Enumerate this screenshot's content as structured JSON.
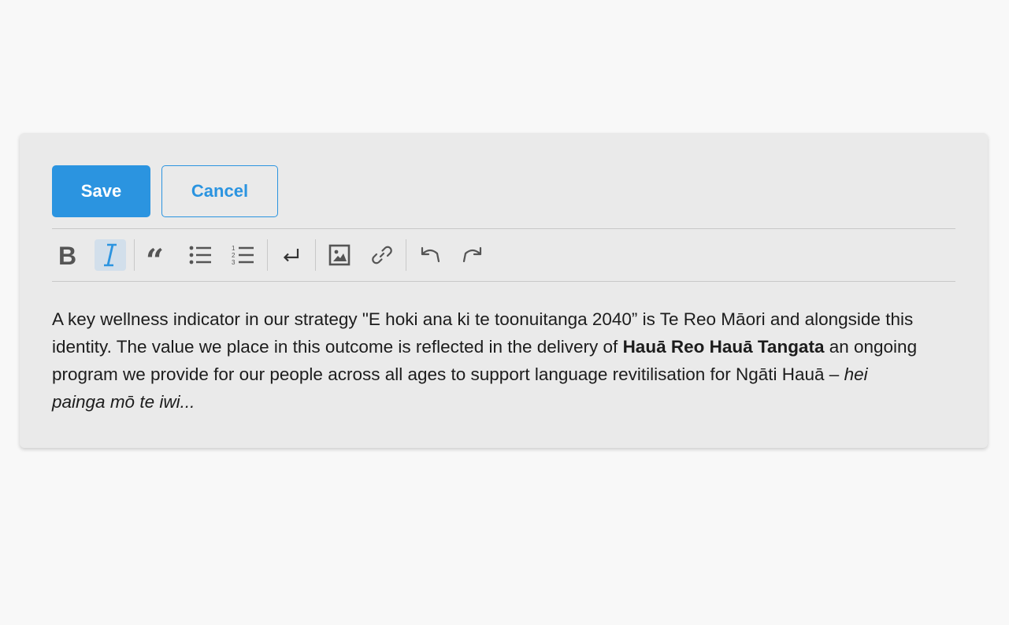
{
  "actions": {
    "save_label": "Save",
    "cancel_label": "Cancel"
  },
  "toolbar": {
    "items": [
      {
        "name": "bold",
        "icon": "bold-icon",
        "active": false
      },
      {
        "name": "italic",
        "icon": "italic-icon",
        "active": true
      },
      {
        "name": "blockquote",
        "icon": "quote-icon",
        "active": false
      },
      {
        "name": "bullet-list",
        "icon": "bullet-list-icon",
        "active": false
      },
      {
        "name": "ordered-list",
        "icon": "ordered-list-icon",
        "active": false
      },
      {
        "name": "hard-break",
        "icon": "return-icon",
        "active": false
      },
      {
        "name": "image",
        "icon": "image-icon",
        "active": false
      },
      {
        "name": "link",
        "icon": "link-icon",
        "active": false
      },
      {
        "name": "undo",
        "icon": "undo-icon",
        "active": false
      },
      {
        "name": "redo",
        "icon": "redo-icon",
        "active": false
      }
    ]
  },
  "content": {
    "text_1": "A key wellness indicator in our strategy \"E hoki ana ki te toonuitanga 2040” is Te Reo Māori and alongside this identity. The value we place in this outcome is reflected in the delivery of ",
    "bold_1": "Hauā Reo Hauā Tangata",
    "text_2": " an ongoing program we provide for our people across all ages to support language revitilisation for Ngāti Hauā – ",
    "italic_1": "hei painga mō te iwi..."
  },
  "colors": {
    "accent": "#2b94e0",
    "card_background": "#eaeaea",
    "page_background": "#f8f8f8",
    "active_tool_background": "#d2dfeb",
    "icon": "#555555",
    "italic_icon": "#2b94e0"
  }
}
